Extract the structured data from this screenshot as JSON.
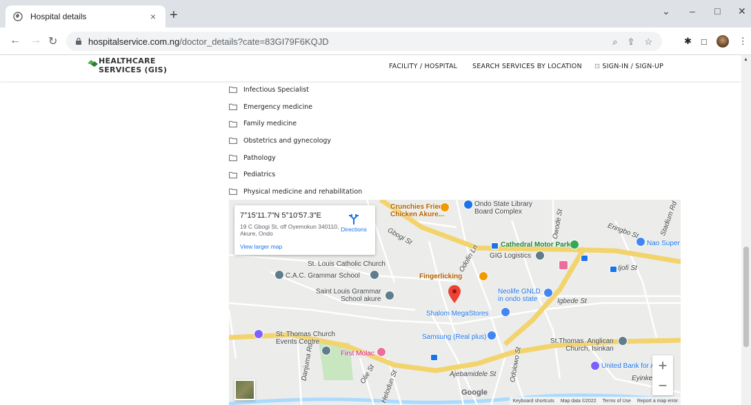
{
  "browser": {
    "tab_title": "Hospital details",
    "tab_close": "×",
    "new_tab": "+",
    "url_host": "hospitalservice.com.ng",
    "url_path": "/doctor_details?cate=83GI79F6KQJD",
    "win_minimize": "–",
    "win_maximize": "□",
    "win_close": "✕",
    "win_dropdown": "⌄"
  },
  "site": {
    "logo_line1": "HEALTHCARE",
    "logo_line2": "SERVICES (GIS)",
    "nav": {
      "facility": "FACILITY / HOSPITAL",
      "search": "SEARCH SERVICES BY LOCATION",
      "signin": "SIGN-IN / SIGN-UP"
    },
    "brand_color": "#4caf50"
  },
  "categories": [
    "Infectious Specialist",
    "Emergency medicine",
    "Family medicine",
    "Obstetrics and gynecology",
    "Pathology",
    "Pediatrics",
    "Physical medicine and rehabilitation"
  ],
  "map": {
    "coordinates": "7°15'11.7\"N 5°10'57.3\"E",
    "address": "19 C Gbogi St, off Oyemokun 340110, Akure, Ondo",
    "directions": "Directions",
    "view_larger": "View larger map",
    "google": "Google",
    "footer": {
      "shortcuts": "Keyboard shortcuts",
      "data": "Map data ©2022",
      "terms": "Terms of Use",
      "report": "Report a map error"
    },
    "zoom_in": "+",
    "zoom_out": "−",
    "places": {
      "crunchies": "Crunchies Fried\nChicken Akure...",
      "library": "Ondo State Library\nBoard Complex",
      "cathedral": "Cathedral Motor Park",
      "nao": "Nao Super",
      "gig": "GIG Logistics",
      "st_louis_church": "St. Louis Catholic Church",
      "cac": "C.A.C. Grammar School",
      "fingerlicking": "Fingerlicking",
      "st_louis_school": "Saint Louis Grammar\nSchool akure",
      "neolife": "Neolife GNLD\nin ondo state",
      "shalom": "Shalom MegaStores",
      "st_thomas": "St. Thomas Church\nEvents Centre",
      "samsung": "Samsung (Real plus)",
      "st_thomas_anglican": "St.Thomas  Anglican\nChurch, Isinkan",
      "first_molac": "First Molac",
      "union_bank": "United Bank for A",
      "ijofi": "Ijofi St",
      "igbede": "Igbede St",
      "ajebamidele": "Ajebamidele St",
      "eringbo": "Eringbo St",
      "eyinke": "Eyinke S",
      "stadium": "Stadium Rd",
      "owode": "Owode St",
      "oduduwa": "Odofin Ln",
      "danjuma": "Danjuma Rd",
      "olie": "Olie St",
      "helodun": "Helodun St",
      "odolowo": "Odolowo St",
      "gbogi": "Gbogi St"
    }
  }
}
